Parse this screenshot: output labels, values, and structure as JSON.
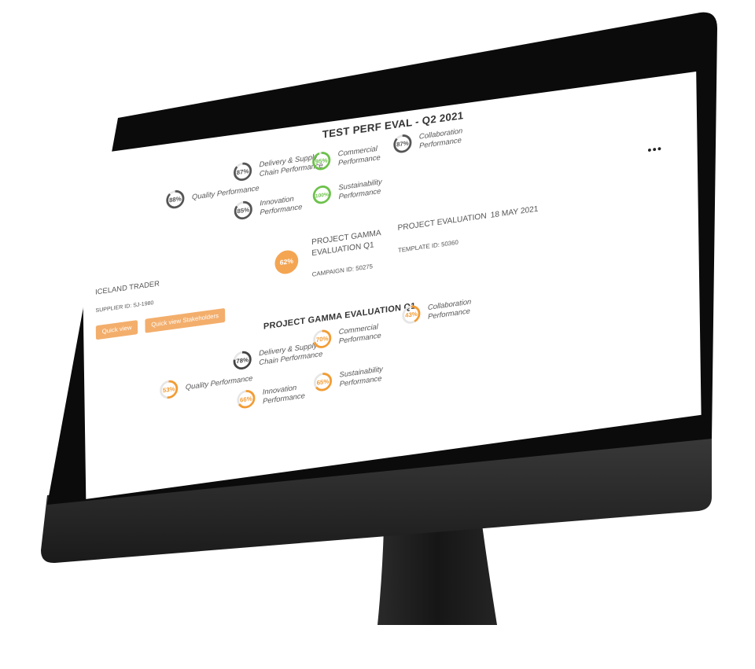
{
  "eval1": {
    "title": "TEST PERF EVAL - Q2 2021",
    "gauges": [
      {
        "name": "quality",
        "pct": "88%",
        "value": 88,
        "label": [
          "Quality Performance"
        ],
        "color": "#555555"
      },
      {
        "name": "delivery",
        "pct": "87%",
        "value": 87,
        "label": [
          "Delivery & Supply",
          "Chain Performance"
        ],
        "color": "#555555"
      },
      {
        "name": "innovation",
        "pct": "85%",
        "value": 85,
        "label": [
          "Innovation",
          "Performance"
        ],
        "color": "#555555"
      },
      {
        "name": "commercial",
        "pct": "95%",
        "value": 95,
        "label": [
          "Commercial",
          "Performance"
        ],
        "color": "#6cc24a"
      },
      {
        "name": "sustainability",
        "pct": "100%",
        "value": 100,
        "label": [
          "Sustainability",
          "Performance"
        ],
        "color": "#6cc24a"
      },
      {
        "name": "collaboration",
        "pct": "87%",
        "value": 87,
        "label": [
          "Collaboration",
          "Performance"
        ],
        "color": "#555555"
      }
    ]
  },
  "project": {
    "score": "62%",
    "name_line1": "PROJECT GAMMA",
    "name_line2": "EVALUATION Q1",
    "campaign_id": "CAMPAIGN ID: 50275",
    "type": "PROJECT EVALUATION",
    "date": "18 MAY 2021",
    "template_id": "TEMPLATE ID: 50360"
  },
  "supplier": {
    "name": "ICELAND TRADER",
    "id": "SUPPLIER ID: SJ-1980",
    "quick_view": "Quick view",
    "quick_view_stakeholders": "Quick view Stakeholders"
  },
  "eval2": {
    "title": "PROJECT GAMMA EVALUATION Q1",
    "gauges": [
      {
        "name": "quality",
        "pct": "53%",
        "value": 53,
        "label": [
          "Quality Performance"
        ],
        "color": "#f39c33"
      },
      {
        "name": "delivery",
        "pct": "78%",
        "value": 78,
        "label": [
          "Delivery & Supply",
          "Chain Performance"
        ],
        "color": "#444444"
      },
      {
        "name": "innovation",
        "pct": "66%",
        "value": 66,
        "label": [
          "Innovation",
          "Performance"
        ],
        "color": "#f39c33"
      },
      {
        "name": "commercial",
        "pct": "70%",
        "value": 70,
        "label": [
          "Commercial",
          "Performance"
        ],
        "color": "#f39c33"
      },
      {
        "name": "sustainability",
        "pct": "65%",
        "value": 65,
        "label": [
          "Sustainability",
          "Performance"
        ],
        "color": "#f39c33"
      },
      {
        "name": "collaboration",
        "pct": "43%",
        "value": 43,
        "label": [
          "Collaboration",
          "Performance"
        ],
        "color": "#f39c33"
      }
    ]
  },
  "colors": {
    "accent": "#f4a552",
    "green": "#6cc24a",
    "bezel": "#0b0b0b"
  }
}
